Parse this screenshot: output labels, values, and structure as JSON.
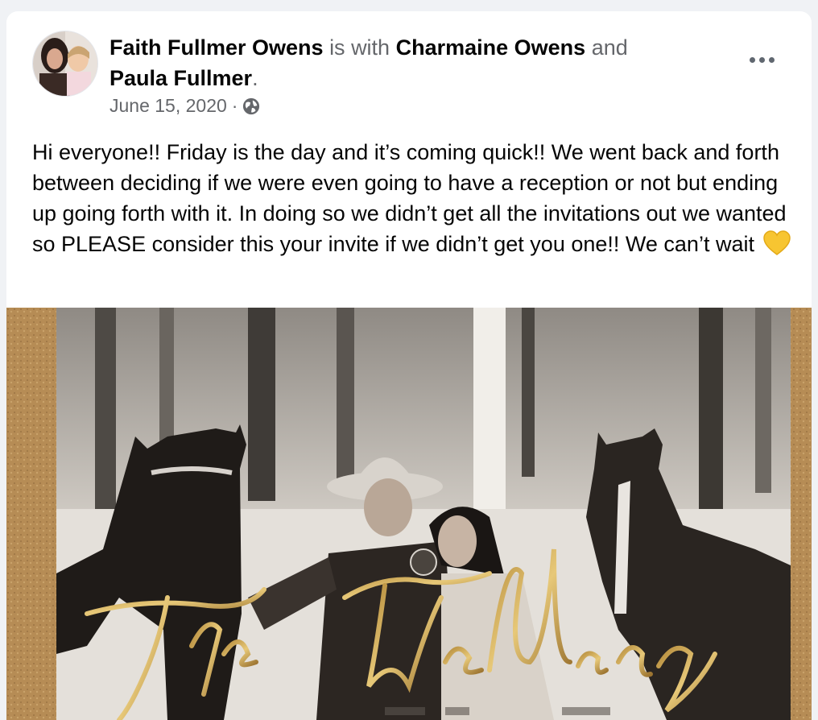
{
  "post": {
    "author": "Faith Fullmer Owens",
    "with_text": "is with",
    "tagged_1": "Charmaine Owens",
    "and_text": "and",
    "tagged_2": "Paula Fullmer",
    "period": ".",
    "date": "June 15, 2020",
    "separator": "·",
    "audience_icon": "globe-icon",
    "more_icon": "more-horizontal-icon",
    "body": "Hi everyone!! Friday is the day and it’s coming quick!! We went back and forth between deciding if we were even going to have a reception or not but ending up going forth with it. In doing so we didn’t get all the invitations out we wanted so PLEASE consider this your invite if we didn’t get you one!! We can’t wait",
    "emoji": "yellow-heart-icon"
  },
  "photo": {
    "script_text": "The Wedding",
    "accent_color": "#c9a24b"
  }
}
